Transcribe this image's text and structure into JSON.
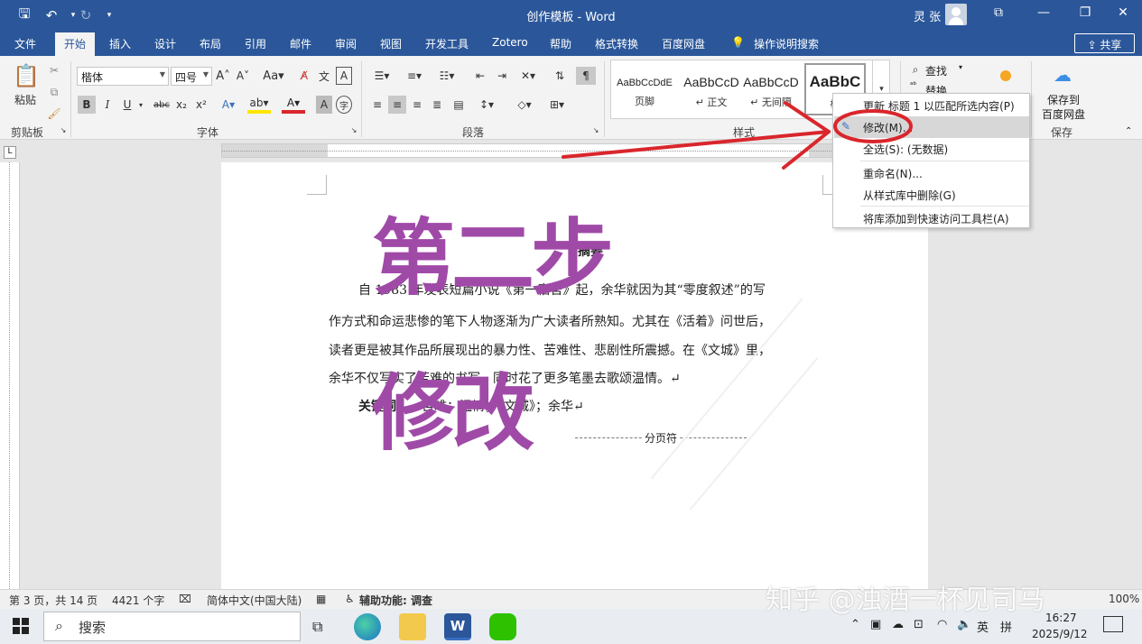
{
  "window": {
    "title": "创作模板  -  Word",
    "user": "灵 张",
    "share": "⇪ 共享"
  },
  "tabs": [
    "文件",
    "开始",
    "插入",
    "设计",
    "布局",
    "引用",
    "邮件",
    "审阅",
    "视图",
    "开发工具",
    "Zotero",
    "帮助",
    "格式转换",
    "百度网盘",
    "操作说明搜索"
  ],
  "ribbon": {
    "paste": "粘贴",
    "clipboard": "剪贴板",
    "font_name": "楷体",
    "font_size": "四号",
    "font_group": "字体",
    "paragraph_group": "段落",
    "styles_group": "样式",
    "styles": [
      {
        "sample": "AaBbCcDdE",
        "name": "页脚"
      },
      {
        "sample": "AaBbCcD",
        "name": "↵ 正文"
      },
      {
        "sample": "AaBbCcD",
        "name": "↵ 无间隔"
      },
      {
        "sample": "AaBbC",
        "name": "标"
      }
    ],
    "find": "查找",
    "replace": "替换",
    "save_baidu_line1": "保存到",
    "save_baidu_line2": "百度网盘",
    "save_group": "保存"
  },
  "context_menu": [
    "更新 标题 1 以匹配所选内容(P)",
    "修改(M)...",
    "全选(S): (无数据)",
    "重命名(N)...",
    "从样式库中删除(G)",
    "将库添加到快速访问工具栏(A)"
  ],
  "document": {
    "heading": "摘要",
    "lines": [
      "自 1983 年发表短篇小说《第一宿舍》起，余华就因为其“零度叙述”的写",
      "作方式和命运悲惨的笔下人物逐渐为广大读者所熟知。尤其在《活着》问世后，",
      "读者更是被其作品所展现出的暴力性、苦难性、悲剧性所震撼。在《文城》里，",
      "余华不仅写实了苦难的书写，同时花了更多笔墨去歌颂温情。↵"
    ],
    "keywords_label": "关键词：",
    "keywords": "苦难；温情；《文城》；余华↵",
    "page_break": "分页符"
  },
  "overlay": {
    "step": "第二步",
    "action": "修改"
  },
  "status": {
    "page": "第 3 页，共 14 页",
    "words": "4421 个字",
    "language": "简体中文(中国大陆)",
    "accessibility": "辅助功能: 调查",
    "zoom": "100%"
  },
  "taskbar": {
    "search": "搜索",
    "ime": "英",
    "time": "16:27",
    "date": "2025/9/12"
  },
  "watermark": "知乎 @浊酒一杯见司马",
  "colors": {
    "word_blue": "#2b579a",
    "annotation_red": "#d9262c",
    "overlay_purple": "#a04aa8"
  }
}
